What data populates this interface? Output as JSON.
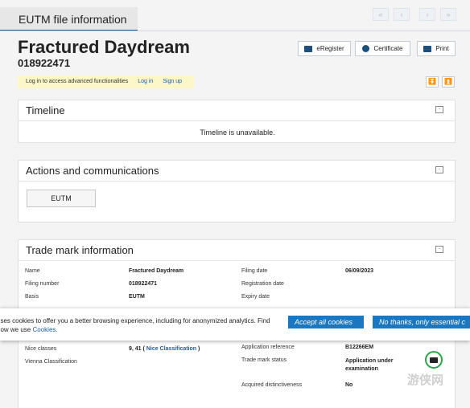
{
  "tab": {
    "label": "EUTM file information"
  },
  "nav": {
    "first": "«",
    "prev": "‹",
    "next": "›",
    "last": "»"
  },
  "header": {
    "title": "Fractured Daydream",
    "number": "018922471"
  },
  "actions": {
    "eregister": "eRegister",
    "certificate": "Certificate",
    "print": "Print"
  },
  "login_bar": {
    "text": "Log in to access advanced functionalities",
    "login": "Log in",
    "signup": "Sign up"
  },
  "expand": {
    "collapse_all": "⏬",
    "expand_all": "⏫"
  },
  "timeline": {
    "title": "Timeline",
    "message": "Timeline is unavailable.",
    "toggle": "-"
  },
  "actions_panel": {
    "title": "Actions and communications",
    "button": "EUTM",
    "toggle": "-"
  },
  "trademark": {
    "title": "Trade mark information",
    "toggle": "-",
    "name_label": "Name",
    "name_value": "Fractured Daydream",
    "filing_number_label": "Filing number",
    "filing_number_value": "018922471",
    "basis_label": "Basis",
    "basis_value": "EUTM",
    "nice_label": "Nice classes",
    "nice_value": "9, 41",
    "nice_link": "Nice Classification",
    "vienna_label": "Vienna Classification",
    "filing_date_label": "Filing date",
    "filing_date_value": "06/09/2023",
    "registration_date_label": "Registration date",
    "expiry_date_label": "Expiry date",
    "app_ref_label": "Application reference",
    "app_ref_value": "B12266EM",
    "status_label": "Trade mark status",
    "status_value": "Application under examination",
    "acquired_label": "Acquired distinctiveness",
    "acquired_value": "No"
  },
  "cookie": {
    "line1": "uses cookies to offer you a better browsing experience, including for anonymized analytics. Find",
    "line2": "how we use",
    "link": "Cookies.",
    "accept": "Accept all cookies",
    "decline": "No thanks, only essential c"
  },
  "watermark": "游侠网",
  "colors": {
    "accent": "#1a77c0",
    "brand": "#1c4f7c",
    "login_bg": "#fcf7c8",
    "status_green": "#27a745"
  }
}
